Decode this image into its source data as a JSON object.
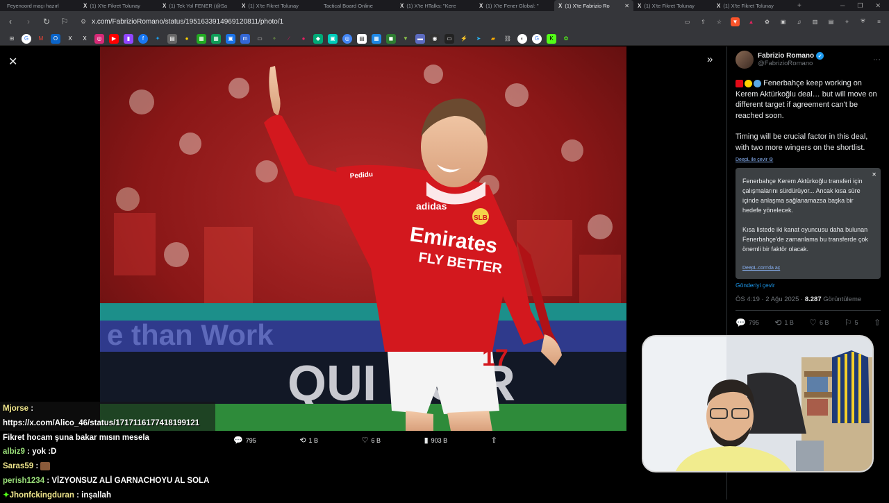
{
  "tabs": [
    {
      "icon": "",
      "title": "Feyenoord maçı hazırl",
      "active": false
    },
    {
      "icon": "X",
      "title": "(1) X'te Fikret Tolunay",
      "active": false
    },
    {
      "icon": "X",
      "title": "(1) Tek Yol FENER (@Sa",
      "active": false
    },
    {
      "icon": "X",
      "title": "(1) X'te Fikret Tolunay",
      "active": false
    },
    {
      "icon": "",
      "title": "Tactical Board Online",
      "active": false
    },
    {
      "icon": "X",
      "title": "(1) X'te HTalks: \"Kere",
      "active": false
    },
    {
      "icon": "X",
      "title": "(1) X'te Fener Global: \"",
      "active": false
    },
    {
      "icon": "X",
      "title": "(1) X'te Fabrizio Ro",
      "active": true
    },
    {
      "icon": "X",
      "title": "(1) X'te Fikret Tolunay",
      "active": false
    },
    {
      "icon": "X",
      "title": "(1) X'te Fikret Tolunay",
      "active": false
    }
  ],
  "address": {
    "url": "x.com/FabrizioRomano/status/1951633914969120811/photo/1"
  },
  "post_actions": {
    "replies": "795",
    "reposts": "1 B",
    "likes": "6 B",
    "views": "903 B"
  },
  "tweet": {
    "name": "Fabrizio Romano",
    "handle": "@FabrizioRomano",
    "para1": "Fenerbahçe keep working on Kerem Aktürkoğlu deal… but will move on different target if agreement can't be reached soon.",
    "para2": "Timing will be crucial factor in this deal, with two more wingers on the shortlist.",
    "deepl_label": "DeepL ile çevir",
    "translation_p1": "Fenerbahçe Kerem Aktürkoğlu transferi için çalışmalarını sürdürüyor... Ancak kısa süre içinde anlaşma sağlanamazsa başka bir hedefe yönelecek.",
    "translation_p2": "Kısa listede iki kanat oyuncusu daha bulunan Fenerbahçe'de zamanlama bu transferde çok önemli bir faktör olacak.",
    "translation_link": "DeepL.com'da aç",
    "translate_post": "Gönderiyi çevir",
    "timestamp": "ÖS 4:19 · 2 Ağu 2025 · ",
    "views_count": "8.287",
    "views_label": "Görüntüleme",
    "replies": "795",
    "reposts": "1 B",
    "likes": "6 B",
    "bookmarks": "5"
  },
  "chat": [
    {
      "user": "Mjorse",
      "msg": ""
    },
    {
      "user": "",
      "msg": "https://x.com/Alico_46/status/1717116177418199121"
    },
    {
      "user": "",
      "msg": "Fikret hocam şuna bakar mısın mesela"
    },
    {
      "user": "albiz9",
      "msg": "yok :D"
    },
    {
      "user": "Saras59",
      "msg": ""
    },
    {
      "user": "perish1234",
      "msg": "VİZYONSUZ ALİ GARNACHOYU AL SOLA"
    },
    {
      "user": "Jhonfckingduran",
      "msg": "inşallah"
    }
  ],
  "colors": {
    "x_blue": "#1d9bf0",
    "benfica_red": "#d3181e",
    "bg": "#000000"
  }
}
